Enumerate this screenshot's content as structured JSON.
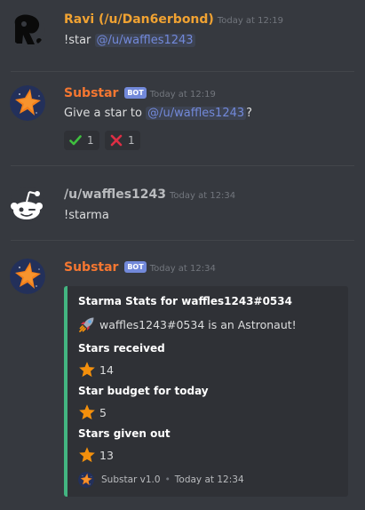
{
  "messages": [
    {
      "author": "Ravi (/u/Dan6erbond)",
      "author_color": "#f0a232",
      "timestamp": "Today at 12:19",
      "avatar": "black-ink-avatar",
      "content_prefix": "!star ",
      "mention": "@/u/waffles1243"
    },
    {
      "author": "Substar",
      "author_color": "#f57731",
      "bot_tag": "BOT",
      "timestamp": "Today at 12:19",
      "avatar": "star-avatar",
      "content_prefix": "Give a star to ",
      "mention": "@/u/waffles1243",
      "content_suffix": "?",
      "reactions": [
        {
          "icon": "check-icon",
          "count": "1"
        },
        {
          "icon": "x-icon",
          "count": "1"
        }
      ]
    },
    {
      "author": "/u/waffles1243",
      "author_color": "#b9bbbe",
      "timestamp": "Today at 12:34",
      "avatar": "reddit-avatar",
      "content": "!starma"
    },
    {
      "author": "Substar",
      "author_color": "#f57731",
      "bot_tag": "BOT",
      "timestamp": "Today at 12:34",
      "avatar": "star-avatar",
      "embed": {
        "accent_color": "#43b581",
        "title": "Starma Stats for waffles1243#0534",
        "description": "waffles1243#0534 is an Astronaut!",
        "description_icon": "rocket-icon",
        "fields": [
          {
            "name": "Stars received",
            "value": "14"
          },
          {
            "name": "Star budget for today",
            "value": "5"
          },
          {
            "name": "Stars given out",
            "value": "13"
          }
        ],
        "footer_text": "Substar v1.0",
        "footer_timestamp": "Today at 12:34"
      }
    }
  ]
}
